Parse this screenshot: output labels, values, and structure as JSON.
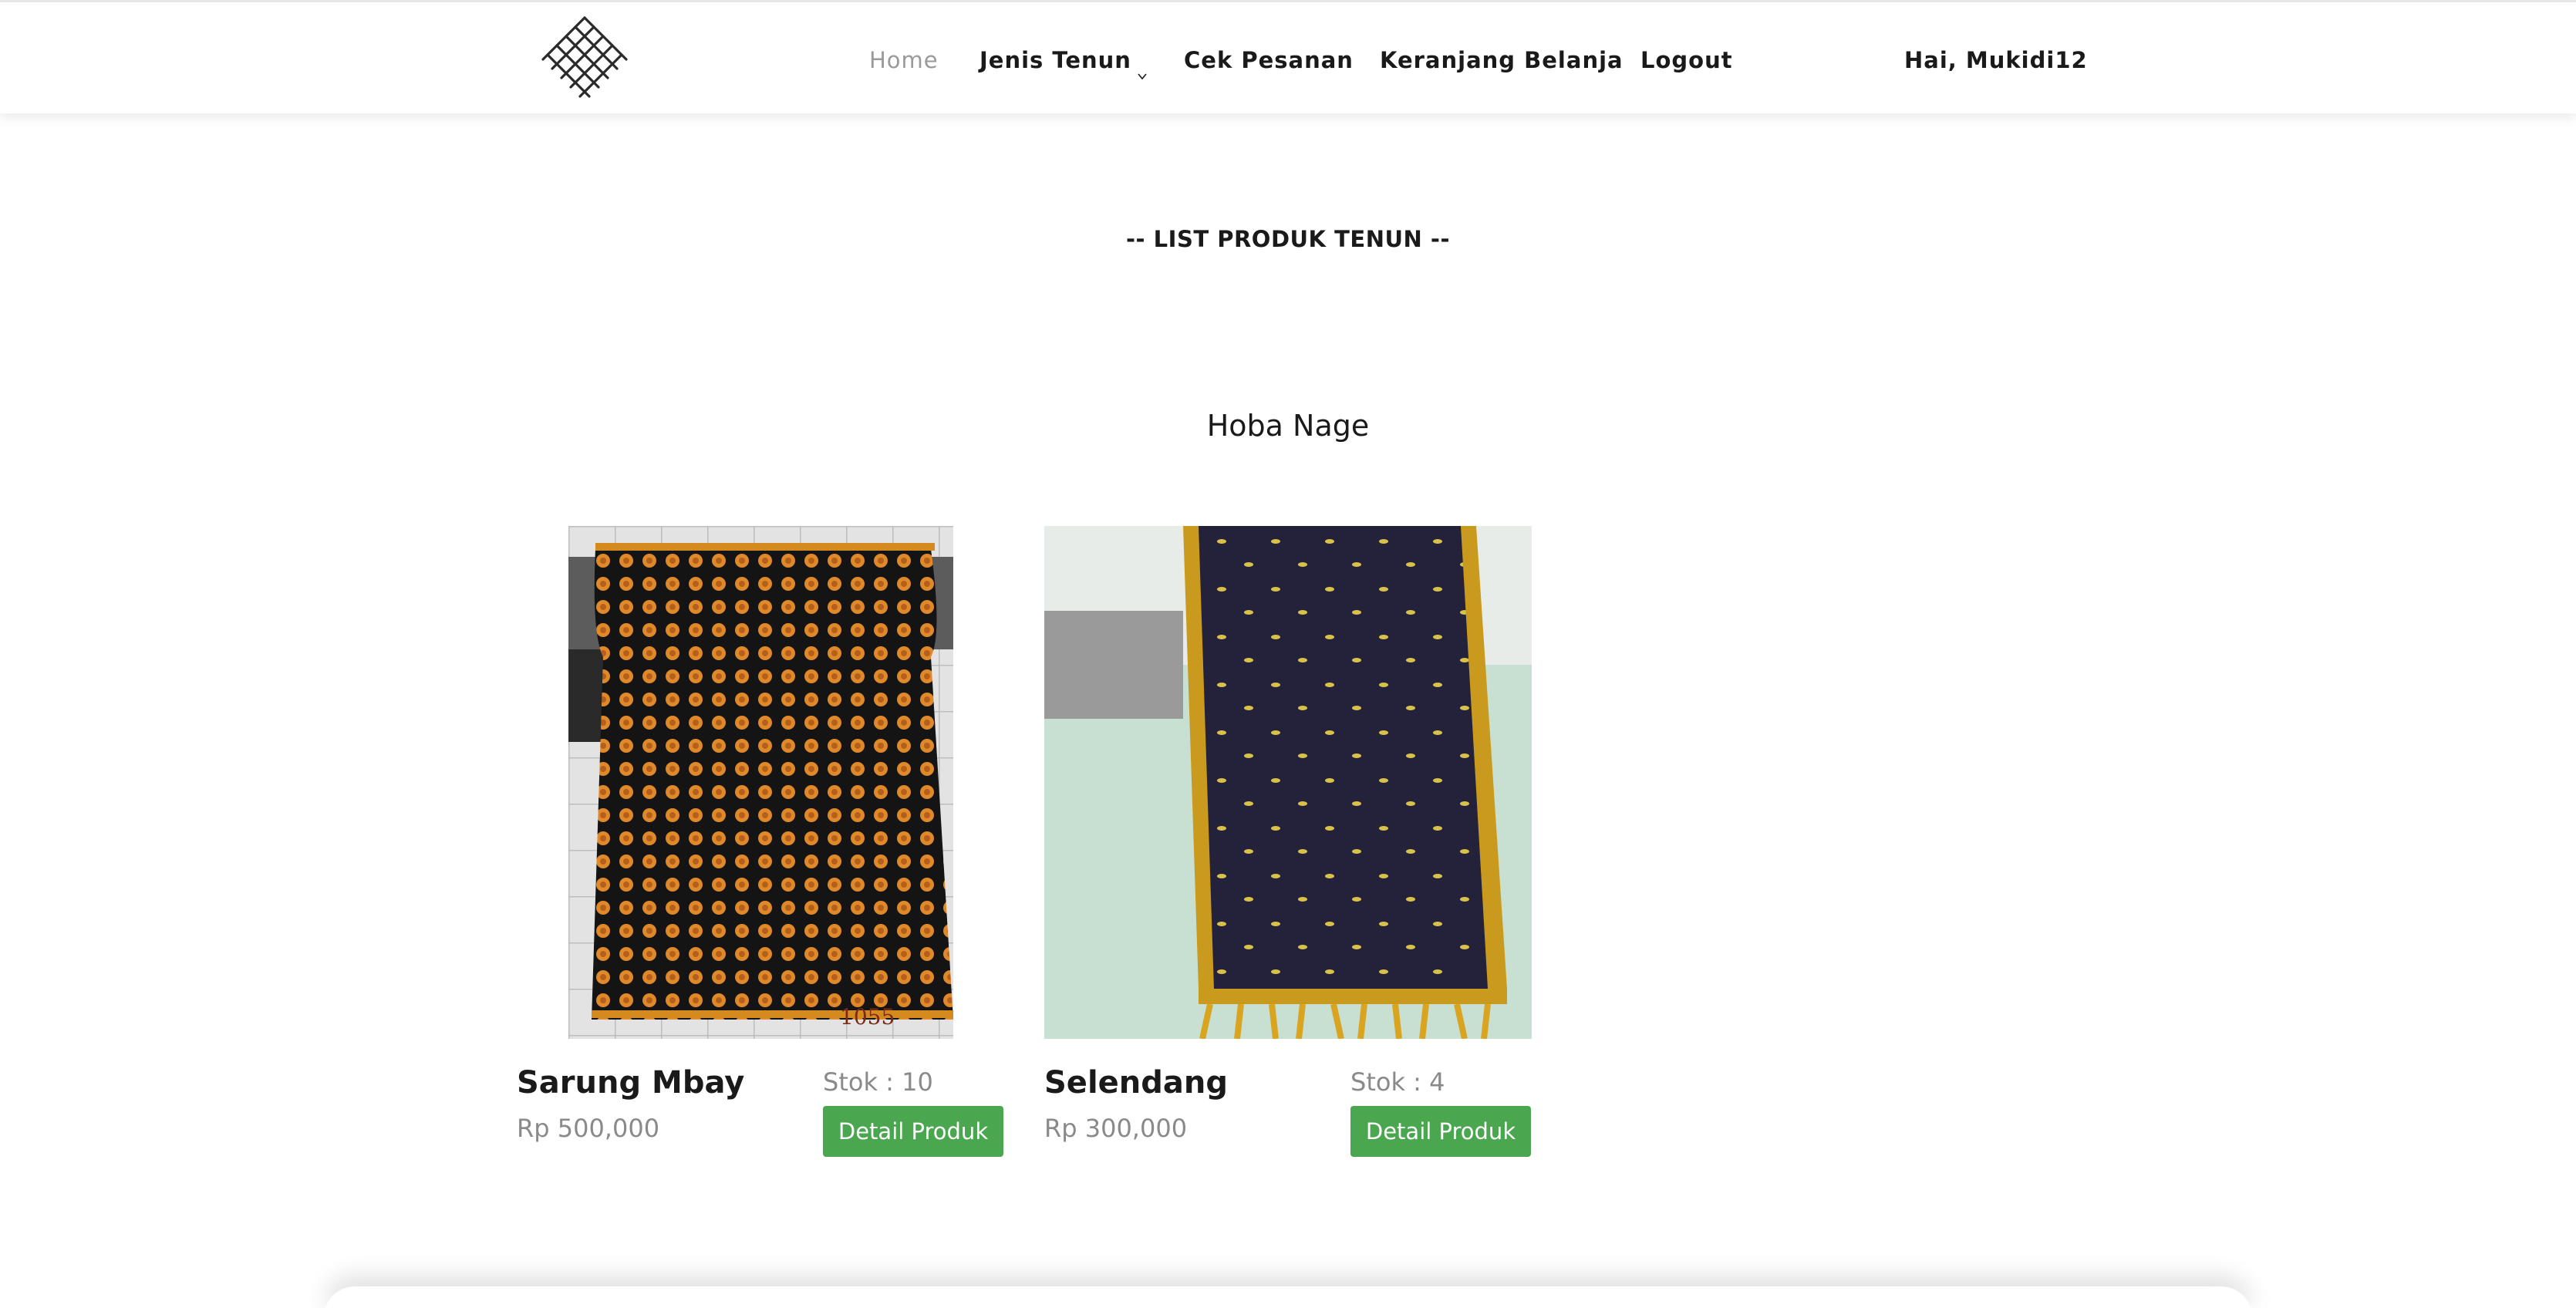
{
  "header": {
    "nav": [
      {
        "label": "Home"
      },
      {
        "label": "Jenis Tenun"
      },
      {
        "label": "Cek Pesanan"
      },
      {
        "label": "Keranjang Belanja"
      },
      {
        "label": "Logout"
      }
    ],
    "greeting": "Hai, Mukidi12"
  },
  "main": {
    "list_title": "-- LIST PRODUK TENUN --",
    "category_title": "Hoba Nage",
    "products": [
      {
        "name": "Sarung Mbay",
        "price": "Rp 500,000",
        "stock": "Stok : 10",
        "button_label": "Detail Produk",
        "image_label": "1055"
      },
      {
        "name": "Selendang",
        "price": "Rp 300,000",
        "stock": "Stok : 4",
        "button_label": "Detail Produk"
      }
    ]
  },
  "colors": {
    "button_green": "#4aa64f",
    "muted_text": "#8a8a8a",
    "active_nav": "#9a9a9a"
  },
  "icons": {
    "logo": "woven-lattice-logo",
    "dropdown": "chevron-down-icon"
  }
}
